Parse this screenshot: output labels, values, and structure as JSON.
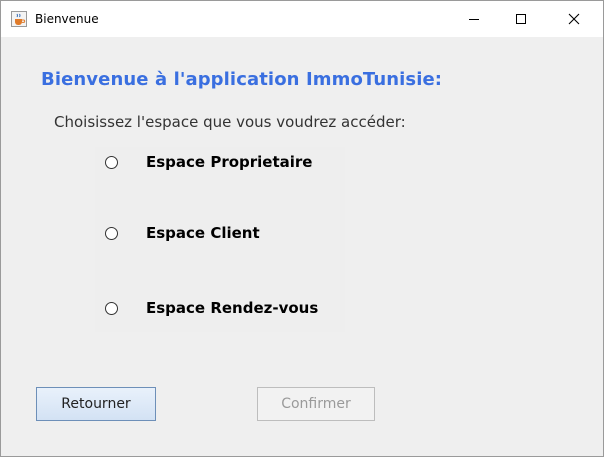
{
  "window": {
    "title": "Bienvenue",
    "icons": {
      "app": "java-cup-icon",
      "minimize": "minimize-icon",
      "maximize": "maximize-icon",
      "close": "close-icon"
    }
  },
  "main": {
    "heading": "Bienvenue à l'application ImmoTunisie:",
    "prompt": "Choisissez l'espace que vous voudrez accéder:",
    "options": [
      {
        "label": "Espace Proprietaire",
        "selected": false
      },
      {
        "label": "Espace Client",
        "selected": false
      },
      {
        "label": "Espace Rendez-vous",
        "selected": false
      }
    ]
  },
  "buttons": {
    "return_label": "Retourner",
    "confirm_label": "Confirmer",
    "confirm_enabled": false
  },
  "colors": {
    "heading": "#3a6fe0",
    "background": "#efefef",
    "disabled_text": "#9a9a9a"
  }
}
